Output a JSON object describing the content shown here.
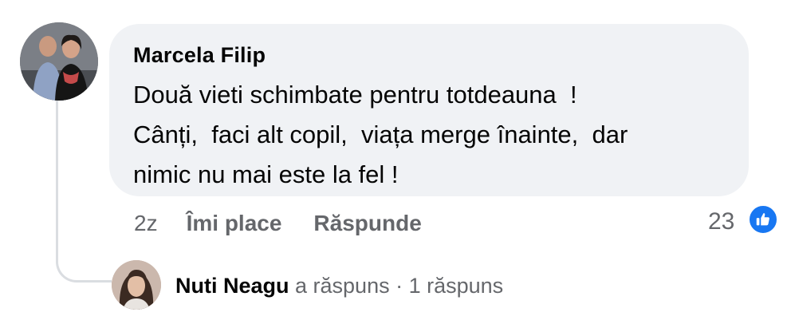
{
  "comment": {
    "author": "Marcela Filip",
    "lines": [
      "Două vieti schimbate pentru totdeauna  !",
      "Cânți,  faci alt copil,  viața merge înainte,  dar",
      "nimic nu mai este la fel !"
    ],
    "time": "2z",
    "like_label": "Îmi place",
    "reply_label": "Răspunde",
    "reaction_count": "23",
    "reaction_icon": "like-thumb-icon"
  },
  "reply_preview": {
    "name": "Nuti Neagu",
    "action": " a răspuns",
    "separator": " · ",
    "count_text": "1 răspuns"
  },
  "colors": {
    "bubble": "#f0f2f5",
    "muted_text": "#65676b",
    "like_blue": "#1877f2",
    "thread_line": "#dadde1"
  }
}
